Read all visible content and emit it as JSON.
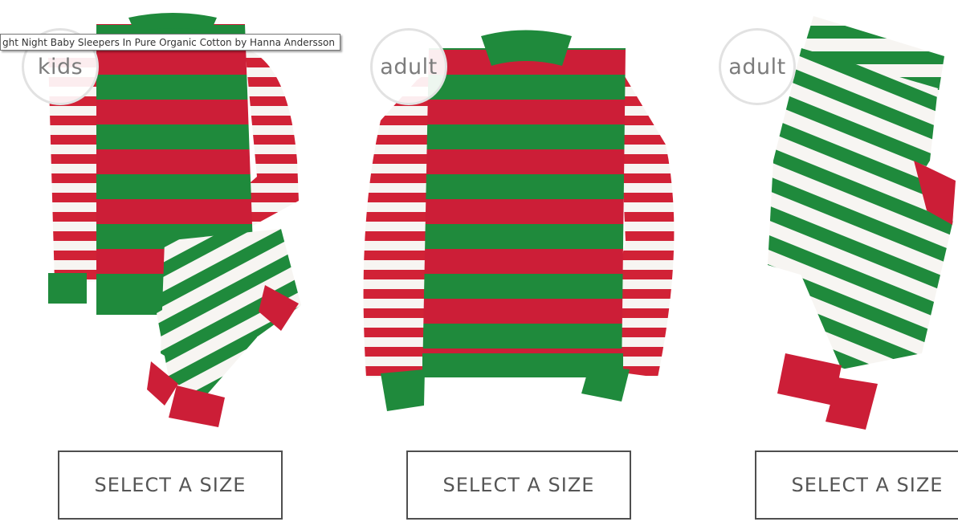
{
  "tooltip": {
    "text": "ght Night Baby Sleepers In Pure Organic Cotton by Hanna Andersson"
  },
  "products": [
    {
      "badge": "kids",
      "button_label": "SELECT A SIZE",
      "image": "kids-striped-pajama-set"
    },
    {
      "badge": "adult",
      "button_label": "SELECT A SIZE",
      "image": "adult-striped-pajama-top"
    },
    {
      "badge": "adult",
      "button_label": "SELECT A SIZE",
      "image": "adult-striped-pajama-pants"
    }
  ],
  "colors": {
    "red": "#cc1e37",
    "green": "#1f8a3c",
    "white": "#ffffff",
    "button_border": "#4f4f4f",
    "badge_text": "#7c7c7c"
  }
}
